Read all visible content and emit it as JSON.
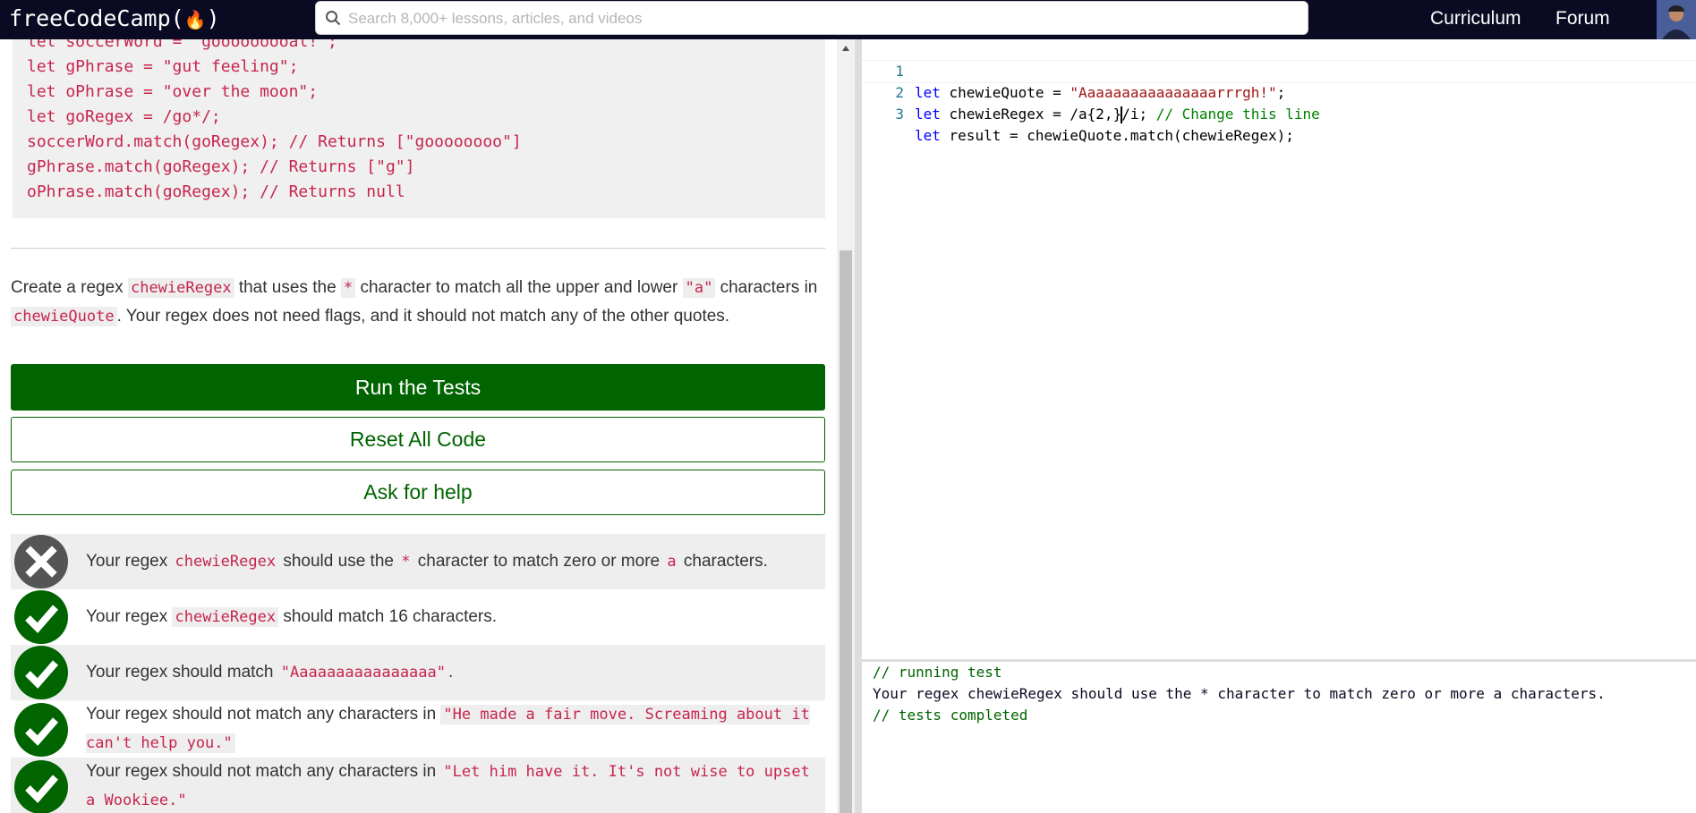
{
  "header": {
    "logo_text": "freeCodeCamp(",
    "logo_flame": "🔥",
    "logo_close": ")",
    "search_placeholder": "Search 8,000+ lessons, articles, and videos",
    "nav": [
      "Curriculum",
      "Forum"
    ]
  },
  "lesson": {
    "code_example": [
      "let soccerWord = \"gooooooooal!\";",
      "let gPhrase = \"gut feeling\";",
      "let oPhrase = \"over the moon\";",
      "let goRegex = /go*/;",
      "soccerWord.match(goRegex); // Returns [\"goooooooo\"]",
      "gPhrase.match(goRegex); // Returns [\"g\"]",
      "oPhrase.match(goRegex); // Returns null"
    ],
    "instructions": {
      "t1": "Create a regex ",
      "c1": "chewieRegex",
      "t2": " that uses the ",
      "c2": "*",
      "t3": " character to match all the upper and lower ",
      "c3": "\"a\"",
      "t4": " characters in ",
      "c4": "chewieQuote",
      "t5": ". Your regex does not need flags, and it should not match any of the other quotes."
    }
  },
  "buttons": {
    "run": "Run the Tests",
    "reset": "Reset All Code",
    "help": "Ask for help"
  },
  "tests": [
    {
      "status": "fail",
      "parts": [
        "Your regex ",
        "chewieRegex",
        " should use the ",
        "*",
        " character to match zero or more ",
        "a",
        " characters."
      ]
    },
    {
      "status": "pass",
      "parts": [
        "Your regex ",
        "chewieRegex",
        " should match 16 characters."
      ]
    },
    {
      "status": "pass",
      "parts": [
        "Your regex should match ",
        "\"Aaaaaaaaaaaaaaaa\"",
        "."
      ]
    },
    {
      "status": "pass",
      "parts": [
        "Your regex should not match any characters in ",
        "\"He made a fair move. Screaming about it can't help you.\""
      ]
    },
    {
      "status": "pass",
      "parts": [
        "Your regex should not match any characters in ",
        "\"Let him have it. It's not wise to upset a Wookiee.\""
      ]
    }
  ],
  "editor": {
    "line_numbers": [
      "1",
      "2",
      "3"
    ],
    "line1": {
      "kw": "let",
      "a": " chewieQuote = ",
      "str": "\"Aaaaaaaaaaaaaaaarrrgh!\"",
      "b": ";"
    },
    "line2": {
      "kw": "let",
      "a": " chewieRegex = /a{2,}",
      "b": "/i; ",
      "cm": "// Change this line"
    },
    "line3": {
      "kw": "let",
      "a": " result = chewieQuote.match(chewieRegex);"
    }
  },
  "console": {
    "lines": [
      "// running test",
      "Your regex chewieRegex should use the * character to match zero or more a characters.",
      "// tests completed"
    ]
  },
  "colors": {
    "nav_bg": "#0a0a23",
    "primary_green": "#006400",
    "code_red": "#c7254e",
    "fail_icon": "#555555",
    "pass_icon": "#006400"
  }
}
